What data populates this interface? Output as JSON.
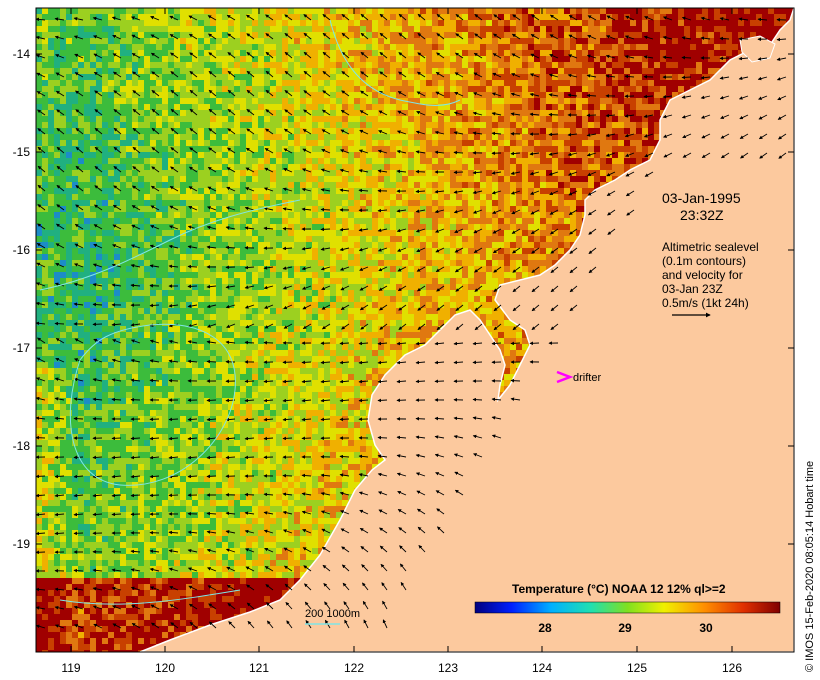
{
  "map": {
    "lon_ticks": [
      "119",
      "120",
      "121",
      "122",
      "123",
      "124",
      "125",
      "126"
    ],
    "lat_ticks": [
      "-14",
      "-15",
      "-16",
      "-17",
      "-18",
      "-19"
    ],
    "date_line1": "03-Jan-1995",
    "date_line2": "23:32Z",
    "legend_lines": [
      "Altimetric sealevel",
      "(0.1m contours)",
      "and velocity for",
      "03-Jan 23Z",
      "0.5m/s (1kt 24h)"
    ],
    "drifter_label": "drifter",
    "scale_label": "200  1000m",
    "colorbar_title": "Temperature (°C) NOAA 12 12% ql>=2",
    "colorbar_ticks": [
      "28",
      "29",
      "30"
    ],
    "colorbar_range": [
      27.3,
      30.5
    ],
    "credit": "© IMOS 15-Feb-2020 08:05:14 Hobart time",
    "colors": {
      "land": "#fcc99e",
      "drifter": "#ff00ff",
      "contour": "#7fe6e6",
      "coast": "#ffffff"
    }
  }
}
